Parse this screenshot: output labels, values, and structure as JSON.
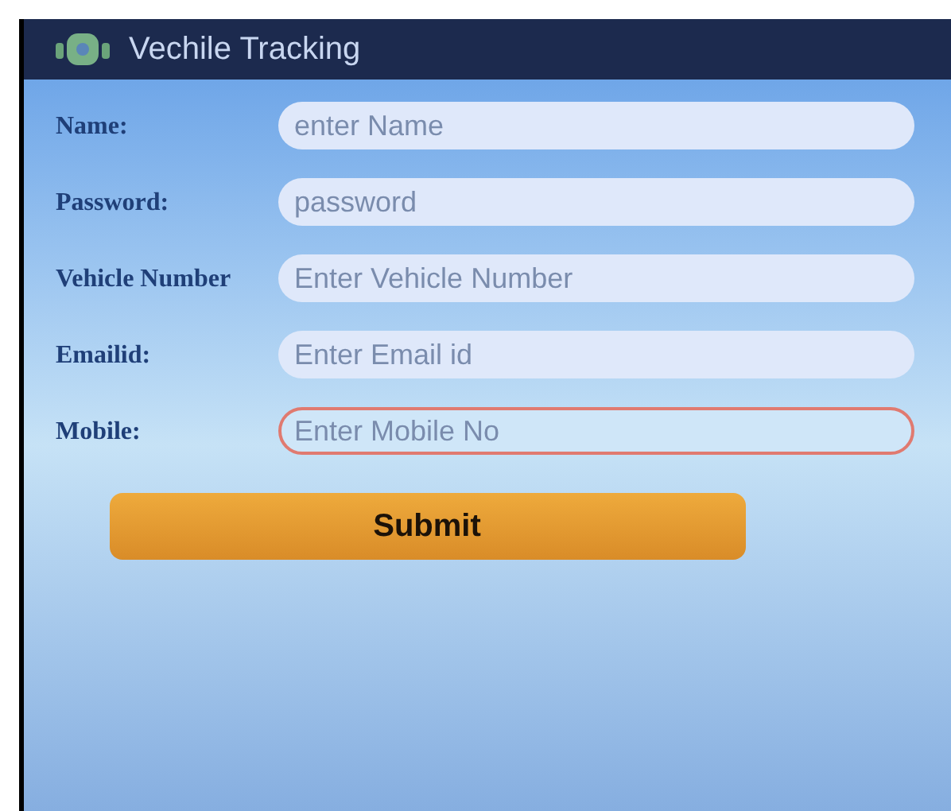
{
  "app_bar": {
    "title": "Vechile Tracking"
  },
  "fields": [
    {
      "label": "Name:",
      "placeholder": "enter Name",
      "focused": false
    },
    {
      "label": "Password:",
      "placeholder": "password",
      "focused": false
    },
    {
      "label": "Vehicle Number",
      "placeholder": "Enter Vehicle Number",
      "focused": false
    },
    {
      "label": "Emailid:",
      "placeholder": "Enter Email id",
      "focused": false
    },
    {
      "label": "Mobile:",
      "placeholder": "Enter Mobile No",
      "focused": true
    }
  ],
  "submit_button": "Submit"
}
